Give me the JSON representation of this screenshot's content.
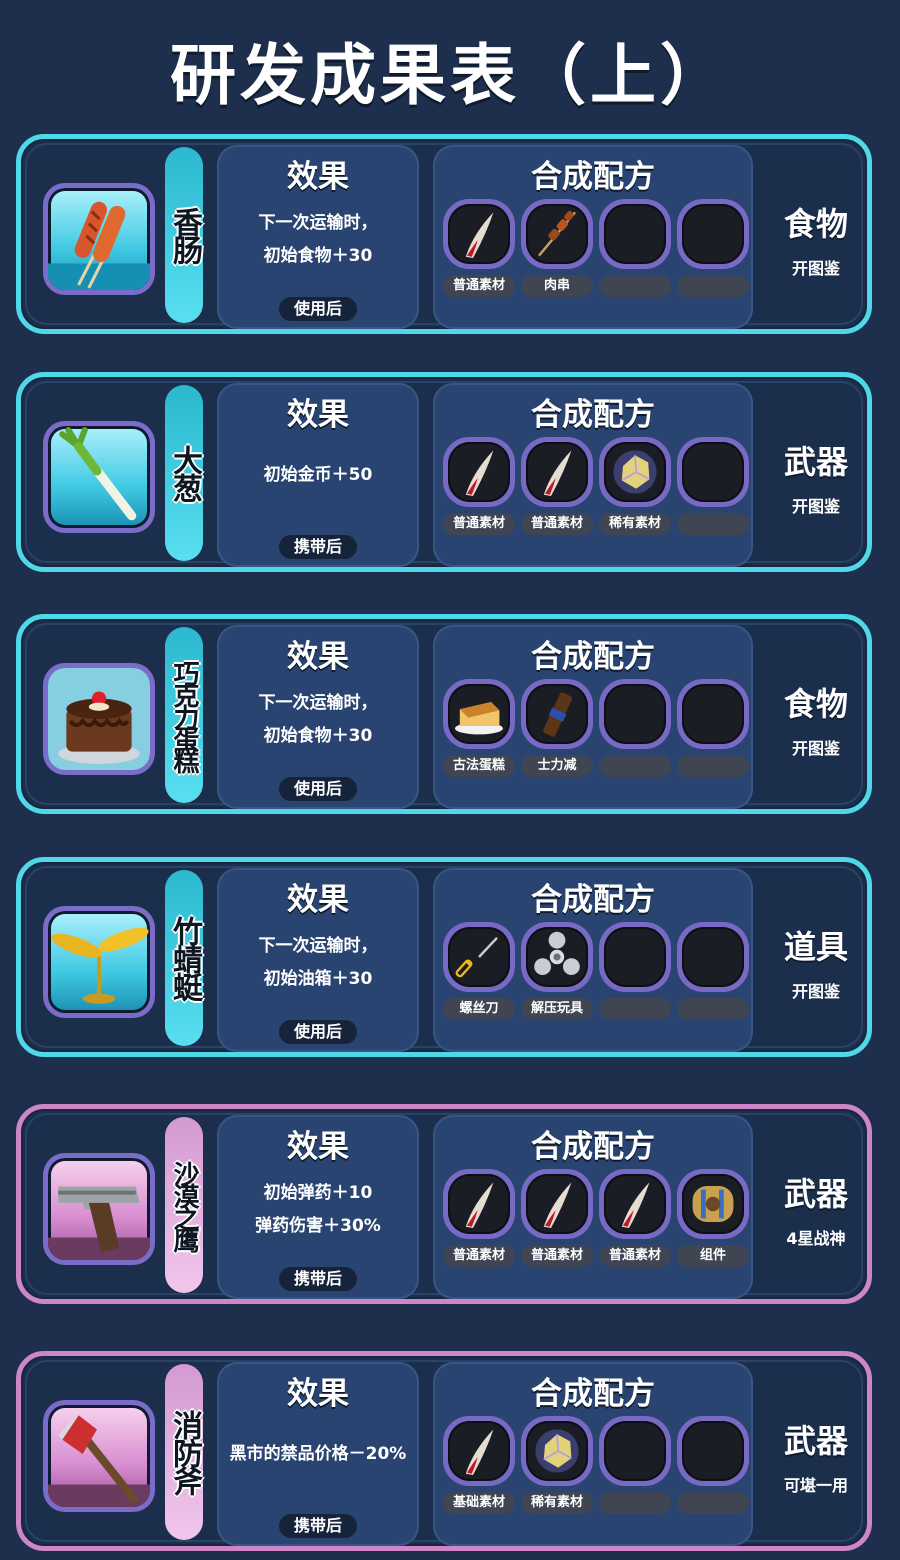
{
  "title": "研发成果表（上）",
  "panel_effect_title": "效果",
  "panel_recipe_title": "合成配方",
  "items": [
    {
      "name": "香肠",
      "effect_lines": [
        "下一次运输时，",
        "初始食物＋30"
      ],
      "effect_tag": "使用后",
      "ingredients": [
        "普通素材",
        "肉串",
        "",
        ""
      ],
      "type": "食物",
      "source": "开图鉴",
      "icon": "sausage-icon",
      "theme": "cyan"
    },
    {
      "name": "大葱",
      "effect_lines": [
        "初始金币＋50"
      ],
      "effect_tag": "携带后",
      "ingredients": [
        "普通素材",
        "普通素材",
        "稀有素材",
        ""
      ],
      "type": "武器",
      "source": "开图鉴",
      "icon": "green-onion-icon",
      "theme": "cyan"
    },
    {
      "name": "巧克力蛋糕",
      "effect_lines": [
        "下一次运输时，",
        "初始食物＋30"
      ],
      "effect_tag": "使用后",
      "ingredients": [
        "古法蛋糕",
        "士力减",
        "",
        ""
      ],
      "type": "食物",
      "source": "开图鉴",
      "icon": "chocolate-cake-icon",
      "theme": "cyan"
    },
    {
      "name": "竹蜻蜓",
      "effect_lines": [
        "下一次运输时，",
        "初始油箱＋30"
      ],
      "effect_tag": "使用后",
      "ingredients": [
        "螺丝刀",
        "解压玩具",
        "",
        ""
      ],
      "type": "道具",
      "source": "开图鉴",
      "icon": "bamboo-copter-icon",
      "theme": "cyan"
    },
    {
      "name": "沙漠之鹰",
      "effect_lines": [
        "初始弹药＋10",
        "弹药伤害＋30%"
      ],
      "effect_tag": "携带后",
      "ingredients": [
        "普通素材",
        "普通素材",
        "普通素材",
        "组件"
      ],
      "type": "武器",
      "source": "4星战神",
      "icon": "desert-eagle-icon",
      "theme": "pink"
    },
    {
      "name": "消防斧",
      "effect_lines": [
        "黑市的禁品价格－20%"
      ],
      "effect_tag": "携带后",
      "ingredients": [
        "基础素材",
        "稀有素材",
        "",
        ""
      ],
      "type": "武器",
      "source": "可堪一用",
      "icon": "fire-axe-icon",
      "theme": "pink"
    }
  ],
  "ingredient_icons": {
    "普通素材": "claw-icon",
    "基础素材": "claw-icon",
    "肉串": "skewer-icon",
    "稀有素材": "crystal-icon",
    "古法蛋糕": "sponge-cake-icon",
    "士力减": "candy-bar-icon",
    "螺丝刀": "screwdriver-icon",
    "解压玩具": "fidget-spinner-icon",
    "组件": "component-icon"
  }
}
